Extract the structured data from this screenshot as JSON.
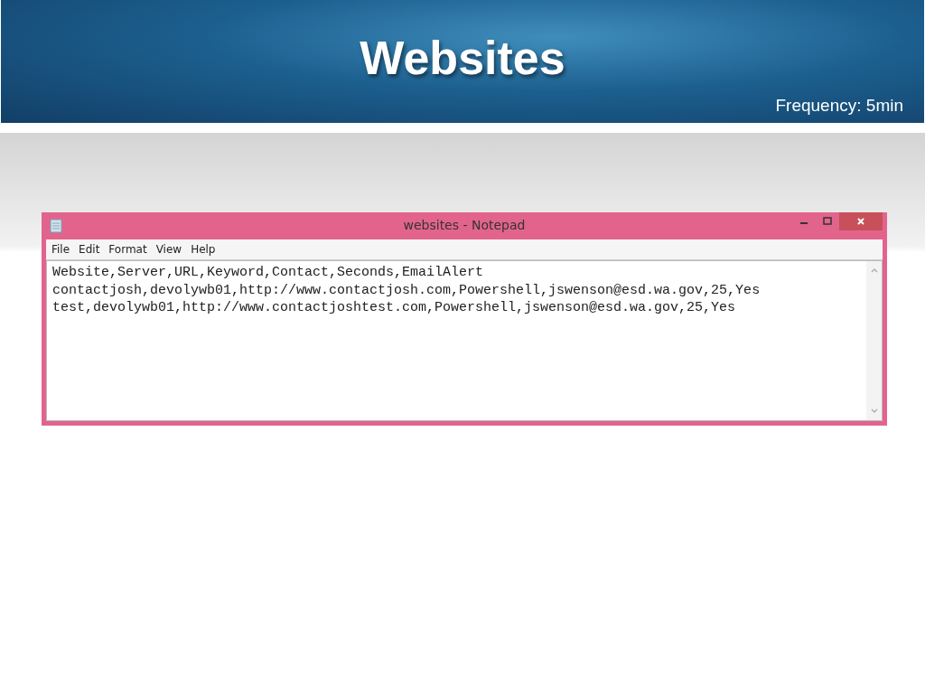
{
  "slide": {
    "title": "Websites",
    "subtitle": "Frequency: 5min"
  },
  "window": {
    "title": "websites - Notepad"
  },
  "menu": [
    "File",
    "Edit",
    "Format",
    "View",
    "Help"
  ],
  "lines": [
    "Website,Server,URL,Keyword,Contact,Seconds,EmailAlert",
    "contactjosh,devolywb01,http://www.contactjosh.com,Powershell,jswenson@esd.wa.gov,25,Yes",
    "test,devolywb01,http://www.contactjoshtest.com,Powershell,jswenson@esd.wa.gov,25,Yes"
  ]
}
